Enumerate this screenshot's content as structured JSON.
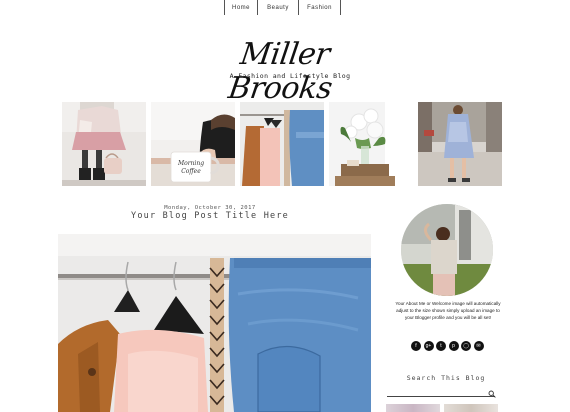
{
  "nav": {
    "items": [
      {
        "label": "Home"
      },
      {
        "label": "Beauty"
      },
      {
        "label": "Fashion"
      }
    ]
  },
  "header": {
    "logo": "Miller Brooks",
    "tagline": "A Fashion and Lifestyle Blog"
  },
  "post": {
    "date": "Monday, October 30, 2017",
    "title": "Your Blog Post Title Here"
  },
  "mug": {
    "text_line1": "Morning",
    "text_line2": "Coffee"
  },
  "sidebar": {
    "about_text": "Your About Me or Welcome image will automatically adjust to the size shown simply upload an image to your Blogger profile and you will be all set!",
    "social_icons": [
      "facebook-icon",
      "google-plus-icon",
      "twitter-icon",
      "pinterest-icon",
      "instagram-icon",
      "email-icon"
    ],
    "search_title": "Search This Blog",
    "search_placeholder": ""
  }
}
